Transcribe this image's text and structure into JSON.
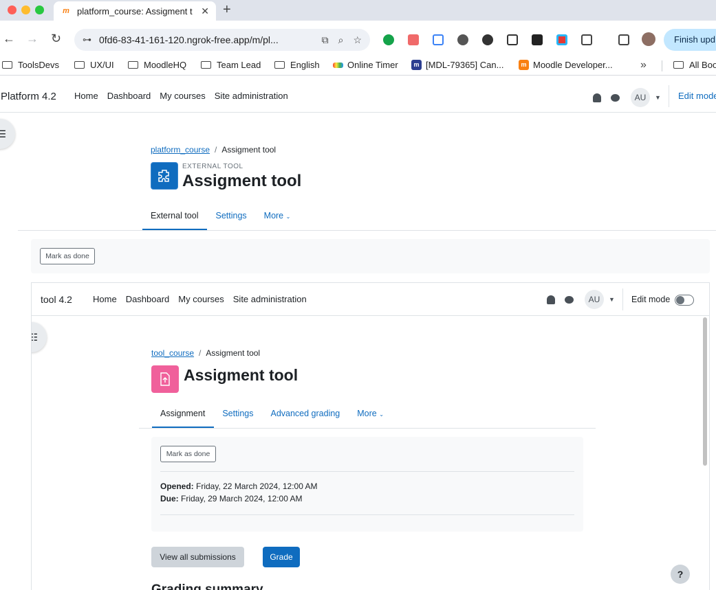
{
  "browser": {
    "tab_title": "platform_course: Assigment t",
    "url": "0fd6-83-41-161-120.ngrok-free.app/m/pl...",
    "finish_update_label": "Finish upd",
    "bookmarks": [
      {
        "label": "ToolsDevs",
        "icon": "folder-icon"
      },
      {
        "label": "UX/UI",
        "icon": "folder-icon"
      },
      {
        "label": "MoodleHQ",
        "icon": "folder-icon"
      },
      {
        "label": "Team Lead",
        "icon": "folder-icon"
      },
      {
        "label": "English",
        "icon": "folder-icon"
      },
      {
        "label": "Online Timer",
        "icon": "timer-favicon"
      },
      {
        "label": "[MDL-79365] Can...",
        "icon": "moodle-tracker-favicon"
      },
      {
        "label": "Moodle Developer...",
        "icon": "moodle-dev-favicon"
      },
      {
        "label": "All Boo",
        "icon": "folder-icon"
      }
    ]
  },
  "platform": {
    "brand": "Platform 4.2",
    "menu": [
      "Home",
      "Dashboard",
      "My courses",
      "Site administration"
    ],
    "avatar_initials": "AU",
    "edit_mode_label": "Edit mode",
    "breadcrumb": {
      "course": "platform_course",
      "current": "Assigment tool"
    },
    "module_type": "EXTERNAL TOOL",
    "title": "Assigment tool",
    "tabs": [
      "External tool",
      "Settings",
      "More"
    ],
    "mark_done_label": "Mark as done"
  },
  "tool": {
    "brand": "tool 4.2",
    "menu": [
      "Home",
      "Dashboard",
      "My courses",
      "Site administration"
    ],
    "avatar_initials": "AU",
    "edit_mode_label": "Edit mode",
    "breadcrumb": {
      "course": "tool_course",
      "current": "Assigment tool"
    },
    "title": "Assigment tool",
    "tabs": [
      "Assignment",
      "Settings",
      "Advanced grading",
      "More"
    ],
    "mark_done_label": "Mark as done",
    "opened_label": "Opened:",
    "opened_value": "Friday, 22 March 2024, 12:00 AM",
    "due_label": "Due:",
    "due_value": "Friday, 29 March 2024, 12:00 AM",
    "view_submissions_label": "View all submissions",
    "grade_label": "Grade",
    "grading_summary_heading": "Grading summary",
    "help_label": "?"
  },
  "colors": {
    "primary": "#0f6cbf",
    "lti_icon": "#0f6cbf",
    "assign_icon": "#f0609b"
  }
}
